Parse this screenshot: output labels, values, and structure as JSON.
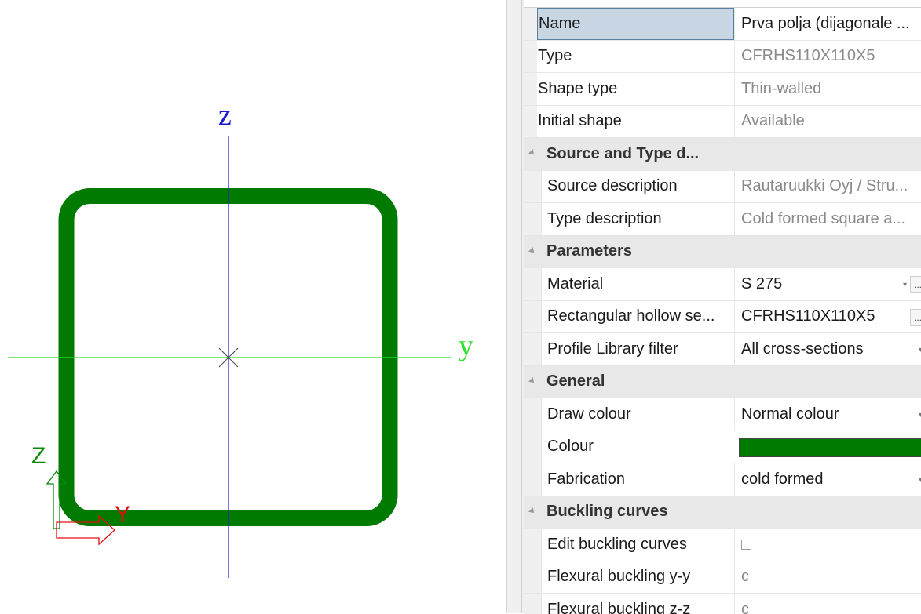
{
  "canvas": {
    "axes": {
      "vertical_label": "z",
      "horizontal_label": "y",
      "vertical_color": "#1a1ad6",
      "horizontal_color": "#2ee22e"
    },
    "lcs": {
      "z_label": "Z",
      "y_label": "Y",
      "z_color": "#0a8a0a",
      "y_color": "#e01010"
    },
    "section_color": "#007a00"
  },
  "properties": {
    "top_rows": [
      {
        "label": "Name",
        "value": "Prva polja (dijagonale ...",
        "readonly": false,
        "selected": true
      },
      {
        "label": "Type",
        "value": "CFRHS110X110X5",
        "readonly": true
      },
      {
        "label": "Shape type",
        "value": "Thin-walled",
        "readonly": true
      },
      {
        "label": "Initial shape",
        "value": "Available",
        "readonly": true
      }
    ],
    "categories": [
      {
        "title": "Source and Type d...",
        "rows": [
          {
            "label": "Source description",
            "value": "Rautaruukki Oyj / Stru...",
            "readonly": true
          },
          {
            "label": "Type description",
            "value": "Cold formed square a...",
            "readonly": true
          }
        ]
      },
      {
        "title": "Parameters",
        "rows": [
          {
            "label": "Material",
            "value": "S 275",
            "dropdown": true,
            "ellipsis": true
          },
          {
            "label": "Rectangular hollow se...",
            "value": "CFRHS110X110X5",
            "ellipsis": true
          },
          {
            "label": "Profile Library filter",
            "value": "All cross-sections",
            "dropdown": true
          }
        ]
      },
      {
        "title": "General",
        "rows": [
          {
            "label": "Draw colour",
            "value": "Normal colour",
            "dropdown": true
          },
          {
            "label": "Colour",
            "value": "",
            "swatch": "#007a00"
          },
          {
            "label": "Fabrication",
            "value": "cold formed",
            "dropdown": true
          }
        ]
      },
      {
        "title": "Buckling curves",
        "rows": [
          {
            "label": "Edit buckling curves",
            "value": "",
            "checkbox": true,
            "checked": false
          },
          {
            "label": "Flexural buckling y-y",
            "value": "c",
            "readonly": true
          },
          {
            "label": "Flexural buckling z-z",
            "value": "c",
            "readonly": true
          }
        ]
      }
    ]
  }
}
